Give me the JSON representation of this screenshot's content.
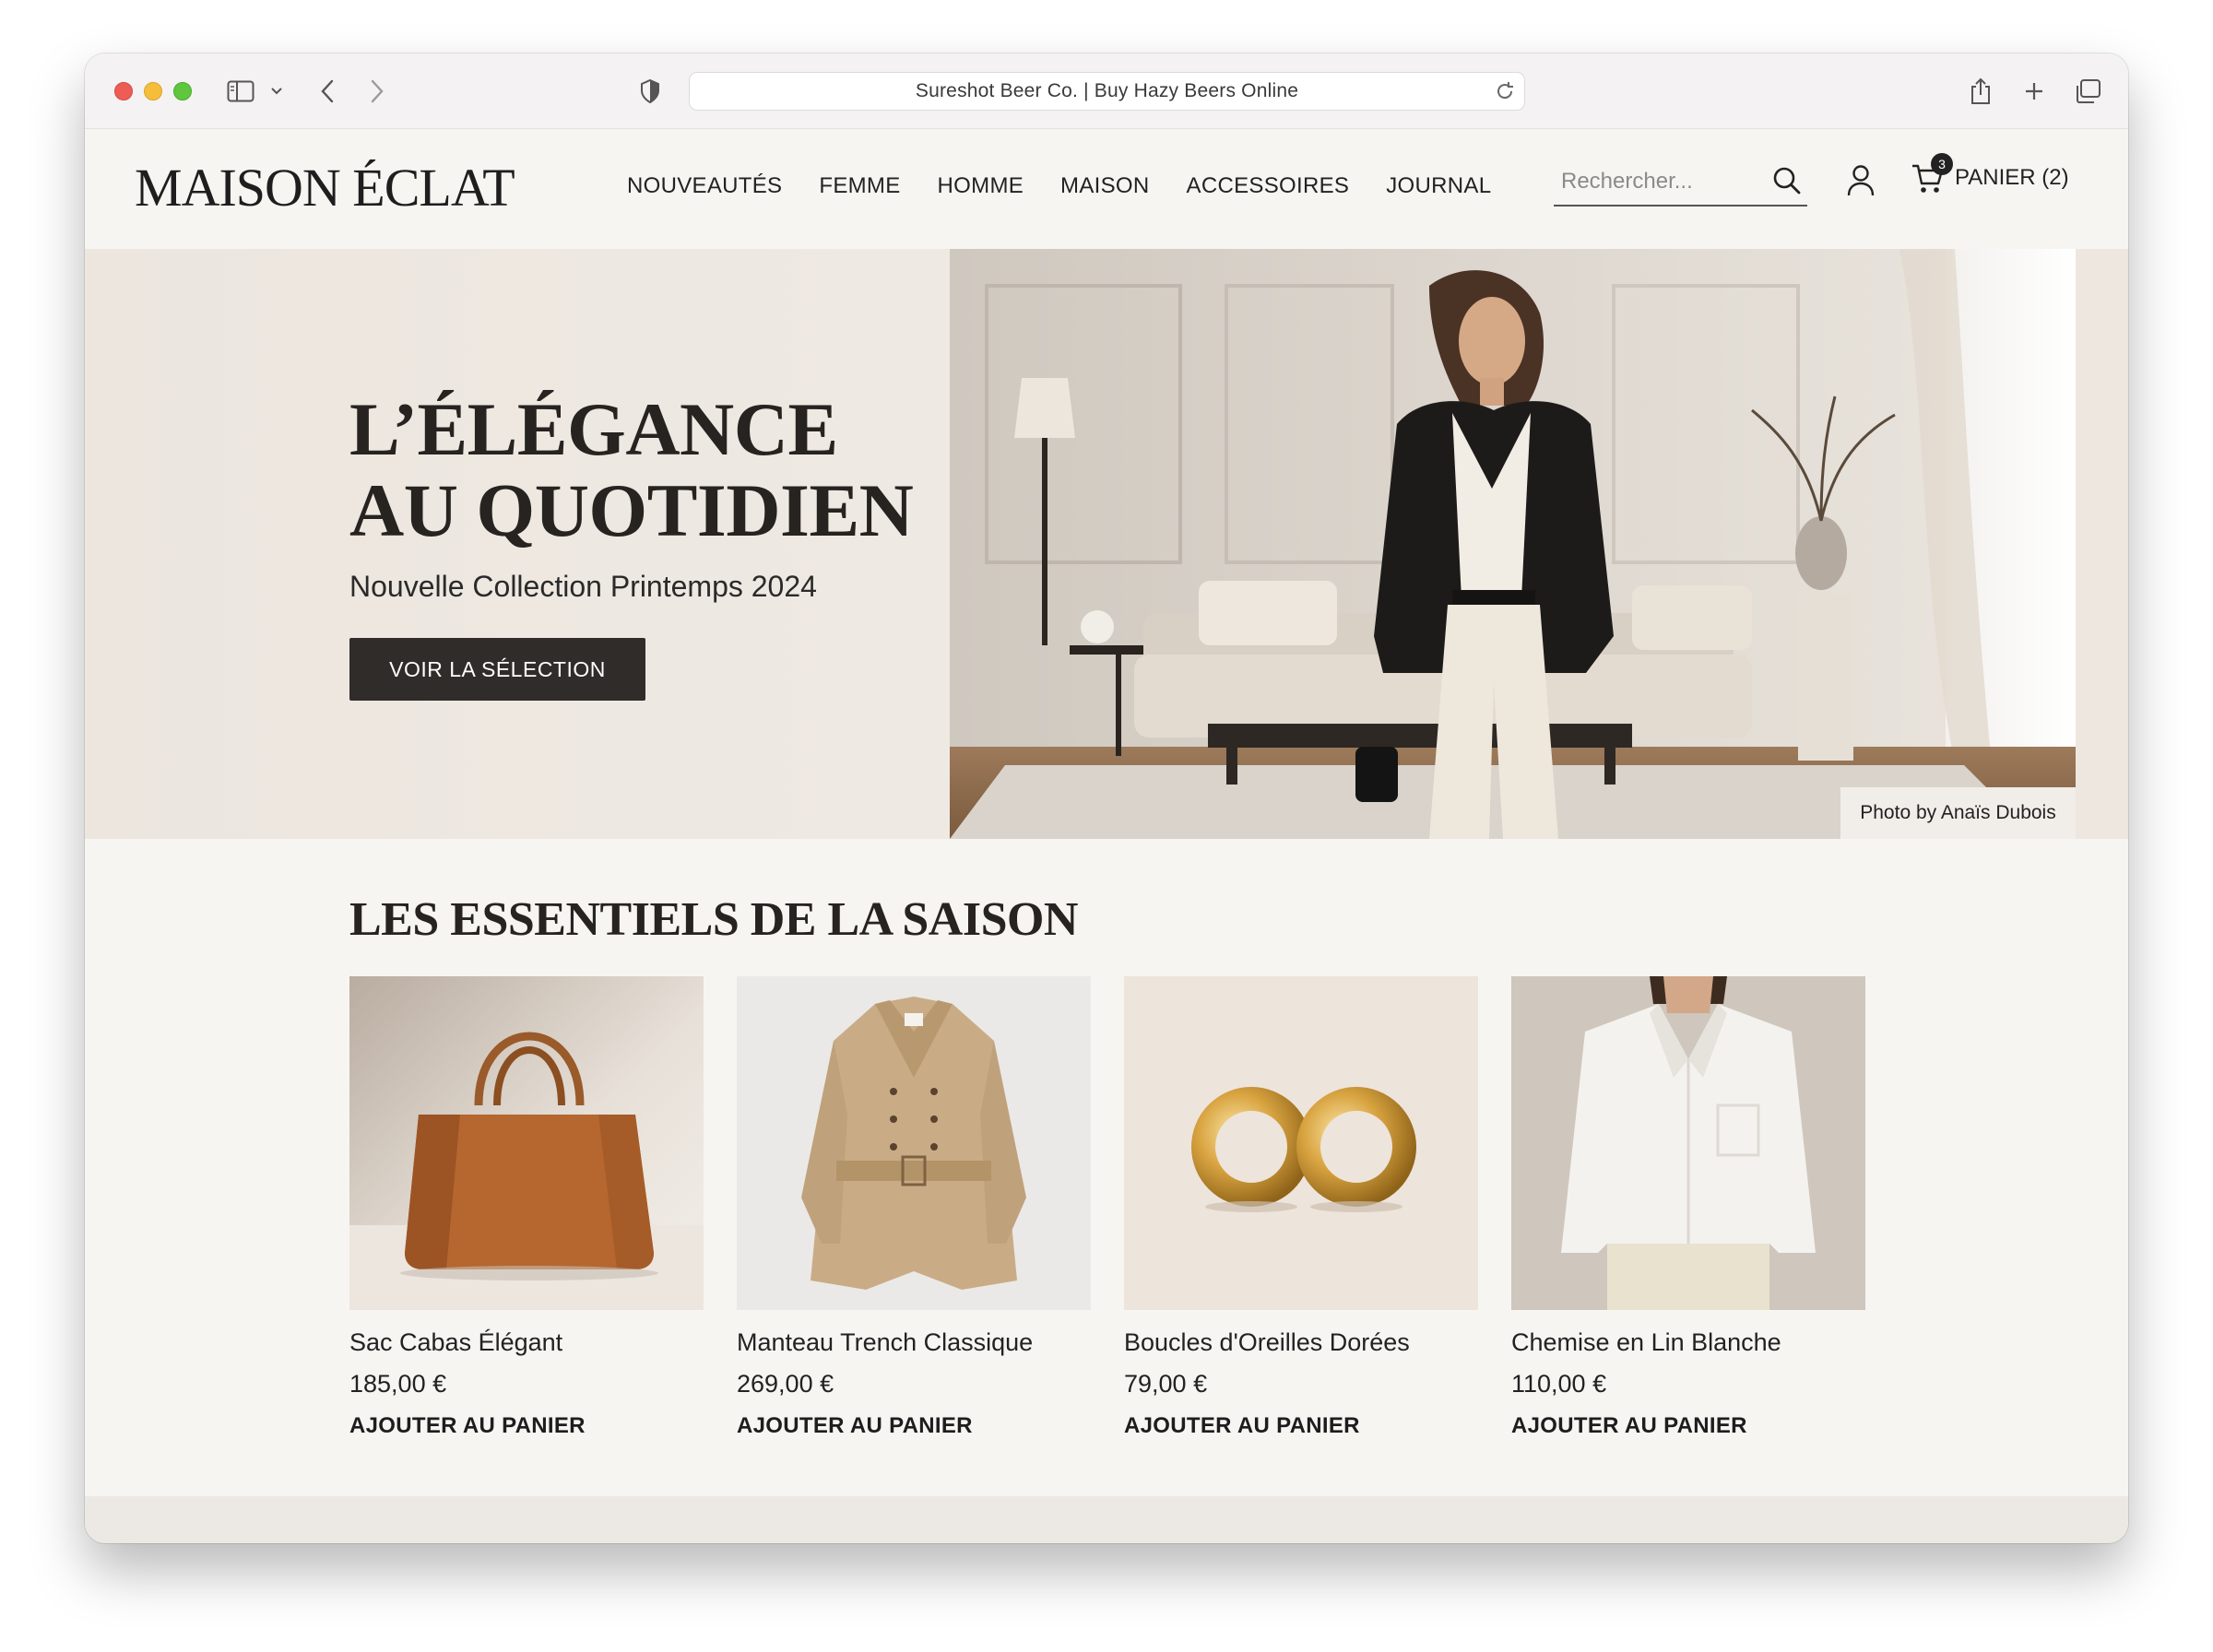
{
  "browser": {
    "url_title": "Sureshot Beer Co. | Buy Hazy Beers Online"
  },
  "site": {
    "logo": "MAISON ÉCLAT",
    "nav": [
      "NOUVEAUTÉS",
      "FEMME",
      "HOMME",
      "MAISON",
      "ACCESSOIRES",
      "JOURNAL"
    ],
    "search_placeholder": "Rechercher...",
    "cart_count": "3",
    "cart_label": "PANIER (2)"
  },
  "hero": {
    "title_line1": "L’ÉLÉGANCE",
    "title_line2": "AU QUOTIDIEN",
    "subtitle": "Nouvelle Collection Printemps 2024",
    "cta": "VOIR LA SÉLECTION",
    "photo_credit": "Photo by Anaïs Dubois"
  },
  "products": {
    "title": "LES ESSENTIELS DE LA SAISON",
    "items": [
      {
        "name": "Sac Cabas Élégant",
        "price": "185,00 €",
        "cta": "AJOUTER AU PANIER"
      },
      {
        "name": "Manteau Trench Classique",
        "price": "269,00 €",
        "cta": "AJOUTER AU PANIER"
      },
      {
        "name": "Boucles d'Oreilles Dorées",
        "price": "79,00 €",
        "cta": "AJOUTER AU PANIER"
      },
      {
        "name": "Chemise en Lin Blanche",
        "price": "110,00 €",
        "cta": "AJOUTER AU PANIER"
      }
    ]
  },
  "colors": {
    "page_bg": "#f7f5f2",
    "hero_bg": "#ece6df",
    "button_dark": "#2f2c2a",
    "text": "#222222"
  }
}
